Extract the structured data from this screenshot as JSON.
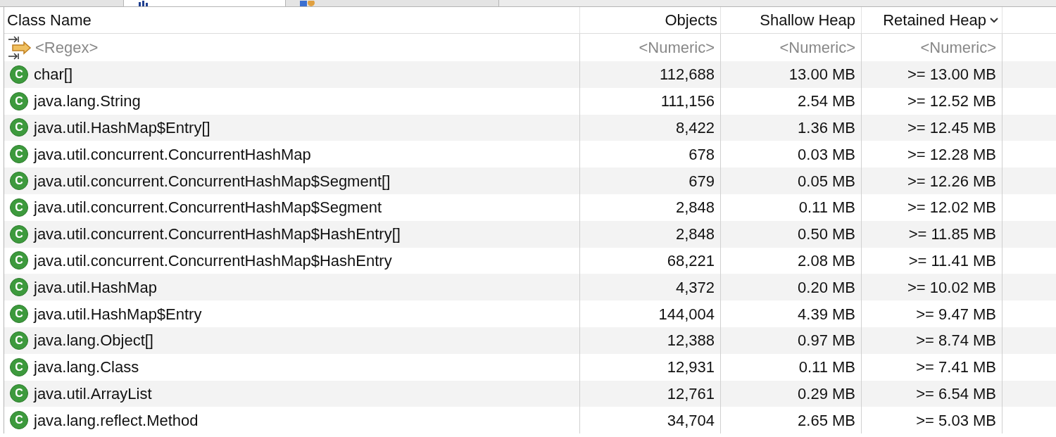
{
  "tabs": [
    {
      "selected": false,
      "kind": "plain"
    },
    {
      "selected": true,
      "kind": "chart"
    },
    {
      "selected": false,
      "kind": "objects"
    }
  ],
  "columns": [
    {
      "label": "Class Name",
      "filter": "<Regex>",
      "sorted": false
    },
    {
      "label": "Objects",
      "filter": "<Numeric>",
      "sorted": false
    },
    {
      "label": "Shallow Heap",
      "filter": "<Numeric>",
      "sorted": false
    },
    {
      "label": "Retained Heap",
      "filter": "<Numeric>",
      "sorted": true
    }
  ],
  "rows": [
    {
      "badge": "C",
      "name": "char[]",
      "objects": "112,688",
      "shallow": "13.00 MB",
      "retained": ">= 13.00 MB"
    },
    {
      "badge": "C",
      "name": "java.lang.String",
      "objects": "111,156",
      "shallow": "2.54 MB",
      "retained": ">= 12.52 MB"
    },
    {
      "badge": "C",
      "name": "java.util.HashMap$Entry[]",
      "objects": "8,422",
      "shallow": "1.36 MB",
      "retained": ">= 12.45 MB"
    },
    {
      "badge": "C",
      "name": "java.util.concurrent.ConcurrentHashMap",
      "objects": "678",
      "shallow": "0.03 MB",
      "retained": ">= 12.28 MB"
    },
    {
      "badge": "C",
      "name": "java.util.concurrent.ConcurrentHashMap$Segment[]",
      "objects": "679",
      "shallow": "0.05 MB",
      "retained": ">= 12.26 MB"
    },
    {
      "badge": "C",
      "name": "java.util.concurrent.ConcurrentHashMap$Segment",
      "objects": "2,848",
      "shallow": "0.11 MB",
      "retained": ">= 12.02 MB"
    },
    {
      "badge": "C",
      "name": "java.util.concurrent.ConcurrentHashMap$HashEntry[]",
      "objects": "2,848",
      "shallow": "0.50 MB",
      "retained": ">= 11.85 MB"
    },
    {
      "badge": "C",
      "name": "java.util.concurrent.ConcurrentHashMap$HashEntry",
      "objects": "68,221",
      "shallow": "2.08 MB",
      "retained": ">= 11.41 MB"
    },
    {
      "badge": "C",
      "name": "java.util.HashMap",
      "objects": "4,372",
      "shallow": "0.20 MB",
      "retained": ">= 10.02 MB"
    },
    {
      "badge": "C",
      "name": "java.util.HashMap$Entry",
      "objects": "144,004",
      "shallow": "4.39 MB",
      "retained": ">= 9.47 MB"
    },
    {
      "badge": "C",
      "name": "java.lang.Object[]",
      "objects": "12,388",
      "shallow": "0.97 MB",
      "retained": ">= 8.74 MB"
    },
    {
      "badge": "C",
      "name": "java.lang.Class",
      "objects": "12,931",
      "shallow": "0.11 MB",
      "retained": ">= 7.41 MB"
    },
    {
      "badge": "C",
      "name": "java.util.ArrayList",
      "objects": "12,761",
      "shallow": "0.29 MB",
      "retained": ">= 6.54 MB"
    },
    {
      "badge": "C",
      "name": "java.lang.reflect.Method",
      "objects": "34,704",
      "shallow": "2.65 MB",
      "retained": ">= 5.03 MB"
    }
  ]
}
